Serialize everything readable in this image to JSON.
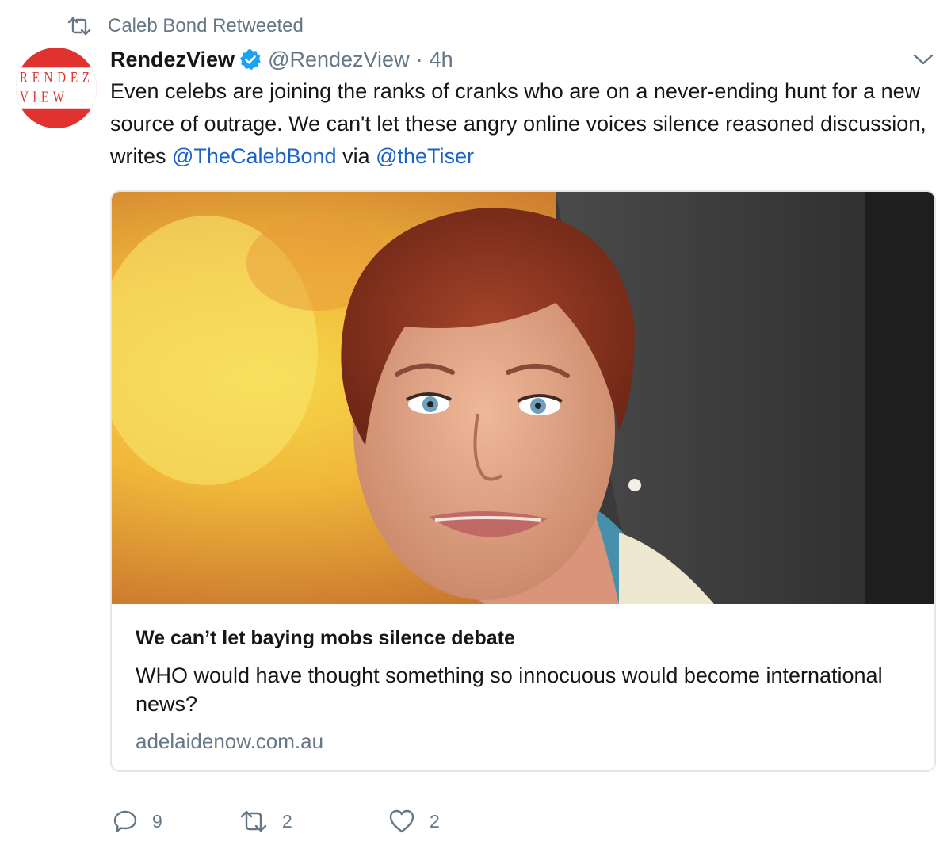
{
  "retweet_context": {
    "icon": "retweet-icon",
    "text": "Caleb Bond Retweeted"
  },
  "author": {
    "avatar_text": "RENDEZ VIEW",
    "avatar_color": "#e0332f",
    "name": "RendezView",
    "handle": "@RendezView",
    "separator": "·",
    "time": "4h",
    "verified": true
  },
  "tweet": {
    "text_before": "Even celebs are joining the ranks of cranks who are on a never-ending hunt for a new source of outrage. We can't let these angry online voices silence reasoned discussion, writes ",
    "mention1": "@TheCalebBond",
    "text_middle": " via ",
    "mention2": "@theTiser",
    "link_color": "#1b62c6"
  },
  "card": {
    "title": "We can’t let baying mobs silence debate",
    "description": "WHO would have thought something so innocuous would become international news?",
    "domain": "adelaidenow.com.au"
  },
  "actions": {
    "reply_count": "9",
    "retweet_count": "2",
    "like_count": "2"
  }
}
